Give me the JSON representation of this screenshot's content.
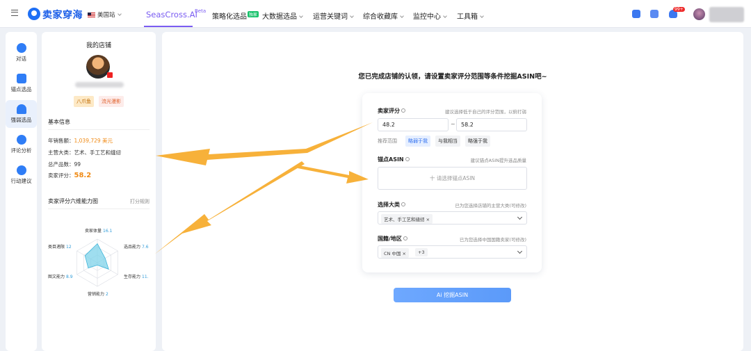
{
  "topbar": {
    "logo": "卖家穿海",
    "region": "美国站",
    "nav": [
      {
        "label": "SeasCross.AI",
        "badge": "Beta"
      },
      {
        "label": "策略化选品",
        "badge": "独家"
      },
      {
        "label": "大数据选品"
      },
      {
        "label": "运营关键词"
      },
      {
        "label": "综合收藏库"
      },
      {
        "label": "监控中心"
      },
      {
        "label": "工具箱"
      }
    ],
    "notifications": "99+"
  },
  "rail": [
    {
      "label": "对话",
      "icon": "chat-icon",
      "color": "#2f7df6"
    },
    {
      "label": "锚点选品",
      "icon": "anchor-icon",
      "color": "#2f7df6"
    },
    {
      "label": "强弱选品",
      "icon": "user-compare-icon",
      "color": "#2f7df6"
    },
    {
      "label": "评论分析",
      "icon": "comment-analysis-icon",
      "color": "#2f7df6"
    },
    {
      "label": "行动建议",
      "icon": "action-icon",
      "color": "#2f7df6"
    }
  ],
  "store": {
    "title": "我的店铺",
    "tags": [
      "八爪鱼",
      "流光漫影"
    ],
    "basic_info_title": "基本信息",
    "annual_sales_label": "年销售额：",
    "annual_sales_value": "1,039,729 美元",
    "main_category": "主营大类：艺术、手工艺和缝纫",
    "total_products": "总产品数：99",
    "seller_score_label": "卖家评分：",
    "seller_score_value": "58.2",
    "radar_title": "卖家评分六维能力图",
    "radar_rule": "打分规则",
    "radar_axes": [
      {
        "name": "卖家体量",
        "value": "16.1",
        "score": 16.1
      },
      {
        "name": "选品能力",
        "value": "7.6",
        "score": 7.6
      },
      {
        "name": "生存能力",
        "value": "11.",
        "score": 11
      },
      {
        "name": "营销能力",
        "value": "2",
        "score": 2
      },
      {
        "name": "图文能力",
        "value": "8.9",
        "score": 8.9
      },
      {
        "name": "类目適限",
        "value": "12",
        "score": 12
      }
    ]
  },
  "main": {
    "title": "您已完成店铺的认领，请设置卖家评分范围等条件挖掘ASIN吧~",
    "score": {
      "label": "卖家评分",
      "hint": "建议选择低于自己的评分范围，以俯打弱",
      "min": "48.2",
      "max": "58.2",
      "tilde": "~",
      "recommend_label": "推荐范围",
      "options": [
        "略弱于我",
        "与我相当",
        "略强于我"
      ],
      "active_option": 0
    },
    "anchor": {
      "label": "锚点ASIN",
      "hint": "建议锚点ASIN提升选品质量",
      "placeholder": "十 请选择锚点ASIN"
    },
    "category": {
      "label": "选择大类",
      "hint": "已为您选择店铺的主营大类(可修改)",
      "chip": "艺术、手工艺和缝纫 ×"
    },
    "nationality": {
      "label": "国籍/地区",
      "hint": "已为您选择中国国籍卖家(可修改)",
      "chip": "CN 中国 ×",
      "more": "+3"
    },
    "submit": "Ai 挖掘ASIN"
  }
}
